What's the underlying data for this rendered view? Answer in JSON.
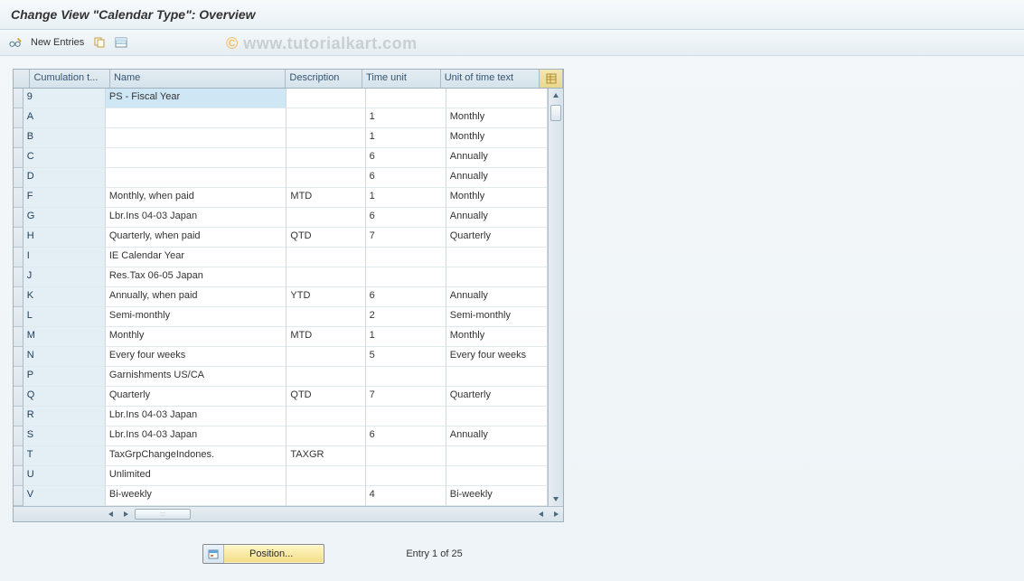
{
  "title": "Change View \"Calendar Type\": Overview",
  "watermark_prefix": "© ",
  "watermark": "www.tutorialkart.com",
  "toolbar": {
    "new_entries": "New Entries"
  },
  "columns": {
    "a": "Cumulation t...",
    "b": "Name",
    "c": "Description",
    "d": "Time unit",
    "e": "Unit of time text"
  },
  "rows": [
    {
      "a": "9",
      "b": "PS - Fiscal Year",
      "c": "",
      "d": "",
      "e": "",
      "sel": true
    },
    {
      "a": "A",
      "b": "",
      "c": "",
      "d": "1",
      "e": "Monthly"
    },
    {
      "a": "B",
      "b": "",
      "c": "",
      "d": "1",
      "e": "Monthly"
    },
    {
      "a": "C",
      "b": "",
      "c": "",
      "d": "6",
      "e": "Annually"
    },
    {
      "a": "D",
      "b": "",
      "c": "",
      "d": "6",
      "e": "Annually"
    },
    {
      "a": "F",
      "b": "Monthly, when paid",
      "c": "MTD",
      "d": "1",
      "e": "Monthly"
    },
    {
      "a": "G",
      "b": "Lbr.Ins 04-03  Japan",
      "c": "",
      "d": "6",
      "e": "Annually"
    },
    {
      "a": "H",
      "b": "Quarterly, when paid",
      "c": "QTD",
      "d": "7",
      "e": "Quarterly"
    },
    {
      "a": "I",
      "b": "IE Calendar Year",
      "c": "",
      "d": "",
      "e": ""
    },
    {
      "a": "J",
      "b": "Res.Tax 06-05  Japan",
      "c": "",
      "d": "",
      "e": ""
    },
    {
      "a": "K",
      "b": "Annually, when paid",
      "c": "YTD",
      "d": "6",
      "e": "Annually"
    },
    {
      "a": "L",
      "b": "Semi-monthly",
      "c": "",
      "d": "2",
      "e": "Semi-monthly"
    },
    {
      "a": "M",
      "b": "Monthly",
      "c": "MTD",
      "d": "1",
      "e": "Monthly"
    },
    {
      "a": "N",
      "b": "Every four weeks",
      "c": "",
      "d": "5",
      "e": "Every four weeks"
    },
    {
      "a": "P",
      "b": "Garnishments US/CA",
      "c": "",
      "d": "",
      "e": ""
    },
    {
      "a": "Q",
      "b": "Quarterly",
      "c": "QTD",
      "d": "7",
      "e": "Quarterly"
    },
    {
      "a": "R",
      "b": "Lbr.Ins 04-03  Japan",
      "c": "",
      "d": "",
      "e": ""
    },
    {
      "a": "S",
      "b": "Lbr.Ins 04-03  Japan",
      "c": "",
      "d": "6",
      "e": "Annually"
    },
    {
      "a": "T",
      "b": "TaxGrpChangeIndones.",
      "c": "TAXGR",
      "d": "",
      "e": ""
    },
    {
      "a": "U",
      "b": "Unlimited",
      "c": "",
      "d": "",
      "e": ""
    },
    {
      "a": "V",
      "b": "Bi-weekly",
      "c": "",
      "d": "4",
      "e": "Bi-weekly"
    }
  ],
  "footer": {
    "position": "Position...",
    "entry": "Entry 1 of 25"
  }
}
